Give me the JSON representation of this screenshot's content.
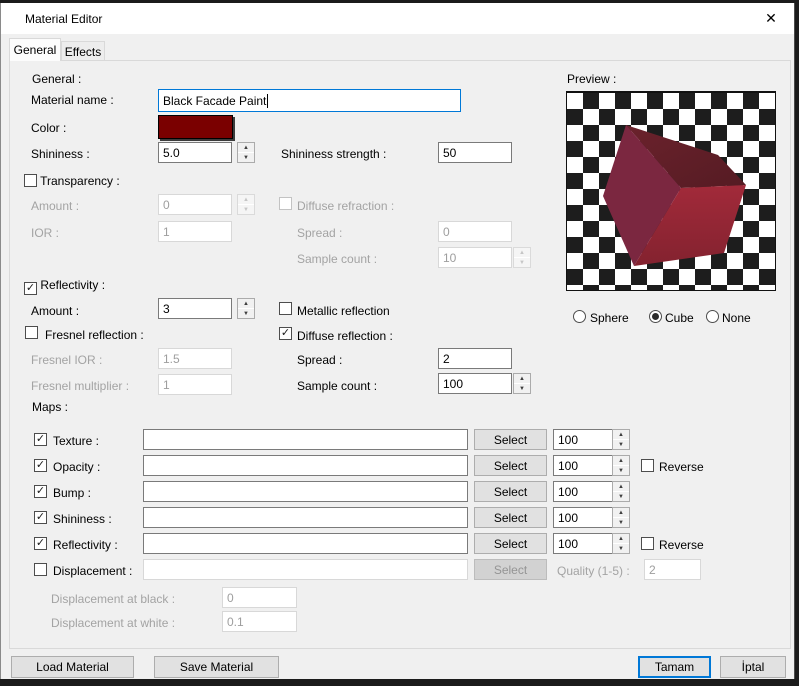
{
  "icons": {
    "close": "✕",
    "check": "✓",
    "spin_up": "▲",
    "spin_down": "▼"
  },
  "colors": {
    "material_color": "#7a0000",
    "accent": "#0078d7",
    "cube_top": "#5e1e27",
    "cube_left": "#7b2740",
    "cube_right": "#a22a3a"
  },
  "window": {
    "title": "Material Editor"
  },
  "tabs": [
    {
      "label": "General",
      "selected": true
    },
    {
      "label": "Effects",
      "selected": false
    }
  ],
  "general": {
    "legend": "General :",
    "material_name_label": "Material name :",
    "material_name_value": "Black Facade Paint",
    "color_label": "Color :",
    "shininess_label": "Shininess :",
    "shininess_value": "5.0",
    "shininess_strength_label": "Shininess strength :",
    "shininess_strength_value": "50"
  },
  "transparency": {
    "legend": "Transparency :",
    "checked": false,
    "amount_label": "Amount :",
    "amount_value": "0",
    "ior_label": "IOR :",
    "ior_value": "1",
    "diffuse_refraction_label": "Diffuse refraction :",
    "diffuse_refraction_checked": false,
    "spread_label": "Spread :",
    "spread_value": "0",
    "sample_count_label": "Sample count :",
    "sample_count_value": "10"
  },
  "reflectivity": {
    "legend": "Reflectivity :",
    "checked": true,
    "amount_label": "Amount :",
    "amount_value": "3",
    "metallic_label": "Metallic reflection",
    "metallic_checked": false,
    "fresnel_label": "Fresnel reflection :",
    "fresnel_checked": false,
    "diffuse_label": "Diffuse reflection :",
    "diffuse_checked": true,
    "fresnel_ior_label": "Fresnel IOR :",
    "fresnel_ior_value": "1.5",
    "spread_label": "Spread :",
    "spread_value": "2",
    "fresnel_multiplier_label": "Fresnel multiplier :",
    "fresnel_multiplier_value": "1",
    "sample_count_label": "Sample count :",
    "sample_count_value": "100"
  },
  "maps": {
    "legend": "Maps :",
    "select_label": "Select",
    "reverse_label": "Reverse",
    "quality_label": "Quality (1-5) :",
    "quality_value": "2",
    "displacement_at_black_label": "Displacement at black :",
    "displacement_at_black_value": "0",
    "displacement_at_white_label": "Displacement at white :",
    "displacement_at_white_value": "0.1",
    "rows": [
      {
        "label": "Texture :",
        "checked": true,
        "path": "",
        "amount": "100",
        "has_reverse": false
      },
      {
        "label": "Opacity :",
        "checked": true,
        "path": "",
        "amount": "100",
        "has_reverse": true,
        "reverse_checked": false
      },
      {
        "label": "Bump :",
        "checked": true,
        "path": "",
        "amount": "100",
        "has_reverse": false
      },
      {
        "label": "Shininess :",
        "checked": true,
        "path": "",
        "amount": "100",
        "has_reverse": false
      },
      {
        "label": "Reflectivity :",
        "checked": true,
        "path": "",
        "amount": "100",
        "has_reverse": true,
        "reverse_checked": false
      },
      {
        "label": "Displacement :",
        "checked": false,
        "path": "",
        "enabled": false
      }
    ]
  },
  "preview": {
    "legend": "Preview :",
    "options": [
      {
        "label": "Sphere",
        "selected": false
      },
      {
        "label": "Cube",
        "selected": true
      },
      {
        "label": "None",
        "selected": false
      }
    ]
  },
  "footer": {
    "load_label": "Load Material",
    "save_label": "Save Material",
    "ok_label": "Tamam",
    "cancel_label": "İptal"
  }
}
